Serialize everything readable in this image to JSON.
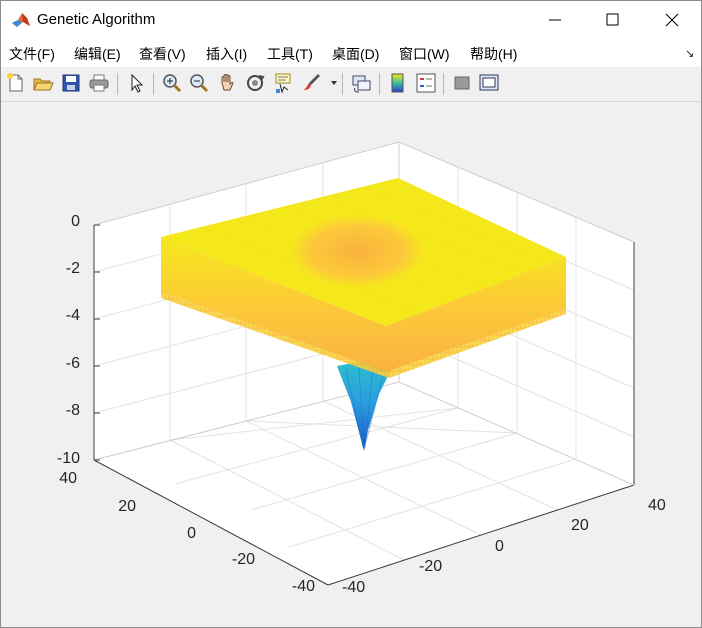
{
  "window": {
    "title": "Genetic Algorithm"
  },
  "menu": {
    "items": [
      {
        "label": "文件(F)"
      },
      {
        "label": "编辑(E)"
      },
      {
        "label": "查看(V)"
      },
      {
        "label": "插入(I)"
      },
      {
        "label": "工具(T)"
      },
      {
        "label": "桌面(D)"
      },
      {
        "label": "窗口(W)"
      },
      {
        "label": "帮助(H)"
      }
    ]
  },
  "toolbar": {
    "buttons": [
      "new-figure-icon",
      "open-file-icon",
      "save-icon",
      "print-icon",
      "select-arrow-icon",
      "zoom-in-icon",
      "zoom-out-icon",
      "pan-hand-icon",
      "rotate-3d-icon",
      "data-cursor-icon",
      "brush-icon",
      "link-plot-icon",
      "colorbar-icon",
      "legend-icon",
      "hide-plot-tools-icon",
      "show-plot-tools-icon"
    ]
  },
  "plot": {
    "z_ticks": [
      "0",
      "-2",
      "-4",
      "-6",
      "-8",
      "-10"
    ],
    "x_ticks": [
      "-40",
      "-20",
      "0",
      "20",
      "40"
    ],
    "y_ticks": [
      "40",
      "20",
      "0",
      "-20",
      "-40"
    ],
    "colors": {
      "high": "#f5e81a",
      "mid": "#fbbd3c",
      "low": "#2a9fde",
      "lowest": "#1a55c8"
    }
  },
  "chart_data": {
    "type": "surface",
    "x_range": [
      -40,
      40
    ],
    "y_range": [
      -40,
      40
    ],
    "zlim": [
      -10,
      0
    ],
    "z_ticks": [
      0,
      -2,
      -4,
      -6,
      -8,
      -10
    ],
    "x_ticks": [
      -40,
      -20,
      0,
      20,
      40
    ],
    "y_ticks": [
      -40,
      -20,
      0,
      20,
      40
    ],
    "surface_plateau_z": -1.5,
    "surface_min_z": -9.6,
    "grid": true,
    "colormap": "parula"
  }
}
